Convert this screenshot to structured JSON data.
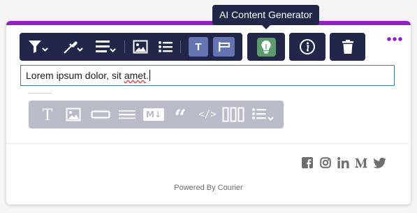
{
  "tooltip": {
    "text": "AI Content Generator"
  },
  "toolbar": {
    "text_style_badge": "T",
    "ai_button_icon": "lightbulb-icon",
    "info_button_icon": "info-icon",
    "delete_button_icon": "trash-icon"
  },
  "editor": {
    "paragraph": {
      "text_before": "Lorem ipsum dolor, sit ",
      "text_misspelled": "amet",
      "text_after": "."
    }
  },
  "blocks_toolbar": {
    "items": [
      "text-block-icon",
      "image-block-icon",
      "button-block-icon",
      "divider-block-icon",
      "markdown-block-icon",
      "quote-block-icon",
      "code-block-icon",
      "columns-block-icon",
      "list-block-icon"
    ],
    "markdown_label": "M↓",
    "code_label": "</>"
  },
  "socials": [
    "facebook-icon",
    "instagram-icon",
    "linkedin-icon",
    "medium-icon",
    "twitter-icon"
  ],
  "footer": {
    "powered_by": "Powered By Courier"
  },
  "colors": {
    "brand_purple": "#9121c2",
    "toolbar_bg": "#22274a",
    "active_button": "#6474b3",
    "ai_button": "#5d9a6e",
    "block_toolbar_bg": "#b9bcc8"
  }
}
